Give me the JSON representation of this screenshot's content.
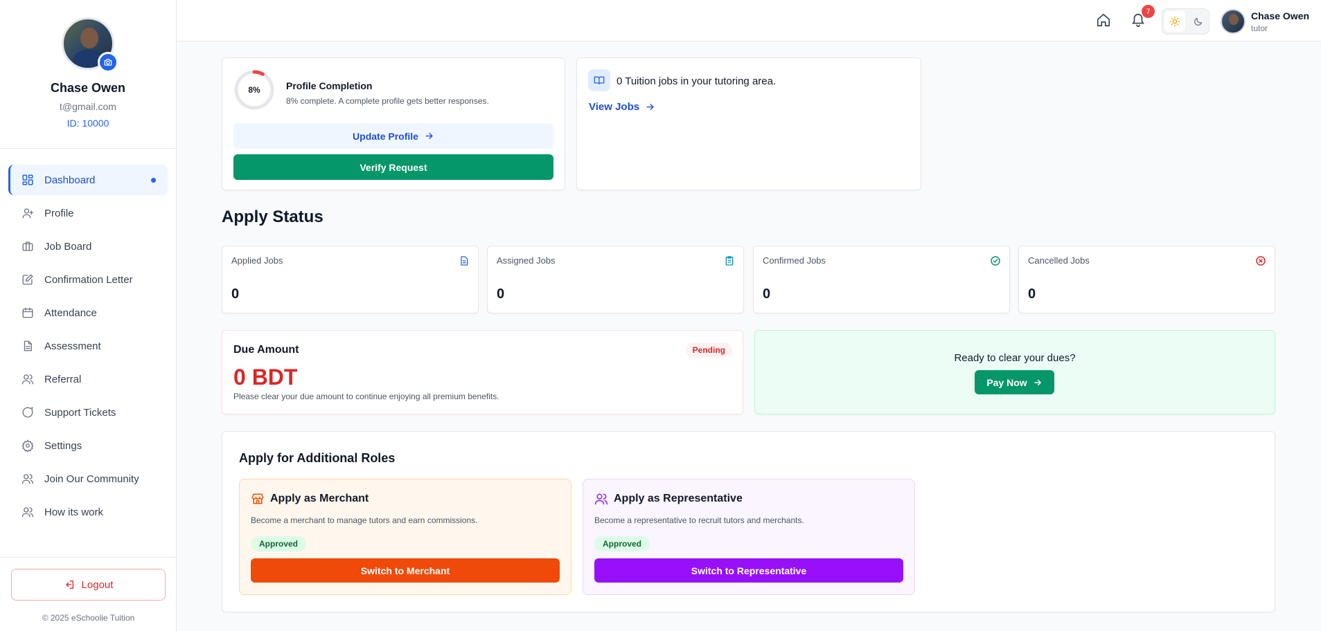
{
  "sidebar": {
    "user_name": "Chase Owen",
    "user_email": "t@gmail.com",
    "user_id": "ID: 10000",
    "nav": [
      {
        "label": "Dashboard",
        "icon": "dashboard-icon"
      },
      {
        "label": "Profile",
        "icon": "user-plus-icon"
      },
      {
        "label": "Job Board",
        "icon": "briefcase-icon"
      },
      {
        "label": "Confirmation Letter",
        "icon": "edit-icon"
      },
      {
        "label": "Attendance",
        "icon": "calendar-icon"
      },
      {
        "label": "Assessment",
        "icon": "document-icon"
      },
      {
        "label": "Referral",
        "icon": "users-icon"
      },
      {
        "label": "Support Tickets",
        "icon": "chat-icon"
      },
      {
        "label": "Settings",
        "icon": "gear-icon"
      },
      {
        "label": "Join Our Community",
        "icon": "users-icon"
      },
      {
        "label": "How its work",
        "icon": "users-icon"
      }
    ],
    "logout_label": "Logout",
    "copyright": "© 2025 eSchoolie Tuition"
  },
  "header": {
    "notification_count": "7",
    "user_name": "Chase Owen",
    "user_role": "tutor"
  },
  "profile_completion": {
    "percent_label": "8%",
    "percent_value": 8,
    "title": "Profile Completion",
    "subtitle": "8% complete. A complete profile gets better responses.",
    "update_label": "Update Profile",
    "verify_label": "Verify Request"
  },
  "jobs": {
    "text": "0 Tuition jobs in your tutoring area.",
    "view_label": "View Jobs"
  },
  "apply_status": {
    "title": "Apply Status",
    "stats": [
      {
        "label": "Applied Jobs",
        "value": "0",
        "color": "#2563eb"
      },
      {
        "label": "Assigned Jobs",
        "value": "0",
        "color": "#0891b2"
      },
      {
        "label": "Confirmed Jobs",
        "value": "0",
        "color": "#059669"
      },
      {
        "label": "Cancelled Jobs",
        "value": "0",
        "color": "#dc2626"
      }
    ]
  },
  "due": {
    "title": "Due Amount",
    "badge": "Pending",
    "amount": "0 BDT",
    "note": "Please clear your due amount to continue enjoying all premium benefits."
  },
  "pay": {
    "question": "Ready to clear your dues?",
    "button_label": "Pay Now"
  },
  "roles": {
    "title": "Apply for Additional Roles",
    "merchant": {
      "title": "Apply as Merchant",
      "description": "Become a merchant to manage tutors and earn commissions.",
      "badge": "Approved",
      "button_label": "Switch to Merchant"
    },
    "representative": {
      "title": "Apply as Representative",
      "description": "Become a representative to recruit tutors and merchants.",
      "badge": "Approved",
      "button_label": "Switch to Representative"
    }
  },
  "colors": {
    "primary": "#2563eb",
    "success": "#059669",
    "danger": "#dc2626",
    "merchant": "#f04a0a",
    "representative": "#9810fa"
  }
}
